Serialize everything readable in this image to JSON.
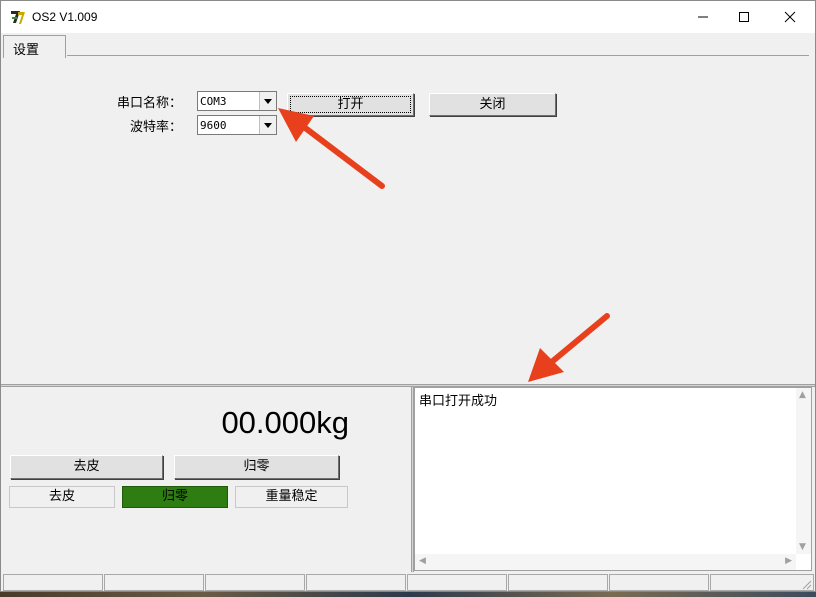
{
  "window": {
    "title": "OS2 V1.009"
  },
  "tabs": [
    {
      "label": "设置"
    }
  ],
  "settings": {
    "port_label": "串口名称：",
    "port_value": "COM3",
    "baud_label": "波特率：",
    "baud_value": "9600",
    "open_button": "打开",
    "close_button": "关闭"
  },
  "scale": {
    "weight": "00.000kg",
    "tare_button": "去皮",
    "zero_button": "归零",
    "indicators": [
      {
        "label": "去皮",
        "active": false
      },
      {
        "label": "归零",
        "active": true
      },
      {
        "label": "重量稳定",
        "active": false
      }
    ]
  },
  "log": {
    "text": "串口打开成功"
  },
  "colors": {
    "indicator_active": "#2e7d12",
    "annotation_arrow": "#e8401c"
  },
  "icons": [
    "app-logo-icon",
    "minimize-icon",
    "maximize-icon",
    "close-icon",
    "dropdown-arrow-icon",
    "resize-grip-icon"
  ]
}
